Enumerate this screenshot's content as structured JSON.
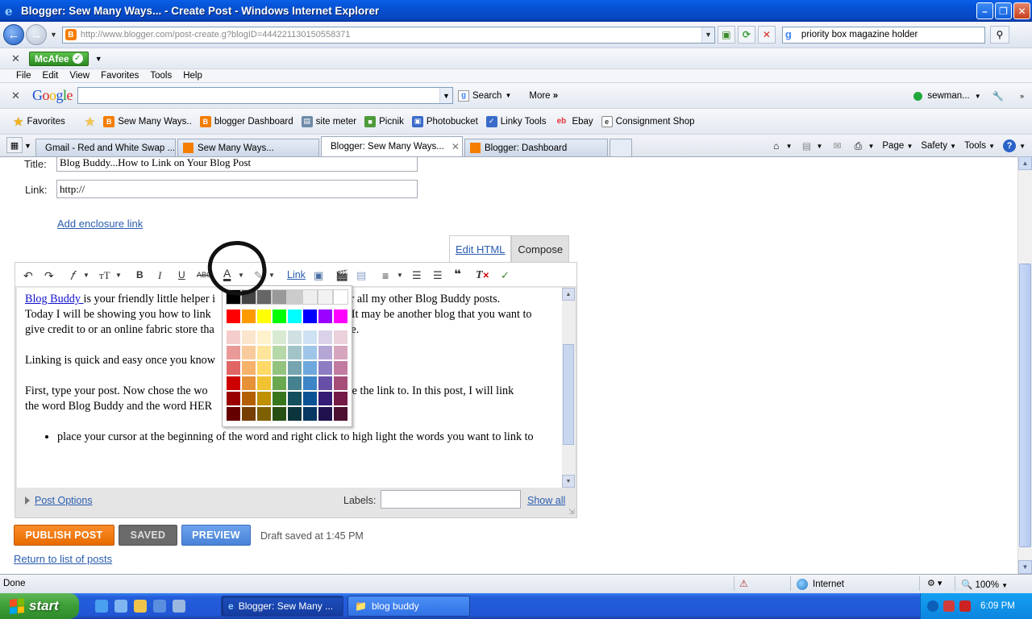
{
  "window": {
    "title": "Blogger: Sew Many Ways... - Create Post - Windows Internet Explorer"
  },
  "address": {
    "url": "http://www.blogger.com/post-create.g?blogID=444221130150558371",
    "search_value": "priority box magazine holder"
  },
  "mcafee": {
    "label": "McAfee"
  },
  "menu": {
    "items": [
      "File",
      "Edit",
      "View",
      "Favorites",
      "Tools",
      "Help"
    ]
  },
  "google_bar": {
    "search_label": "Search",
    "more_label": "More",
    "user": "sewman..."
  },
  "favorites": {
    "label": "Favorites",
    "links": [
      "Sew Many Ways..",
      "blogger Dashboard",
      "site meter",
      "Picnik",
      "Photobucket",
      "Linky Tools",
      "Ebay",
      "Consignment Shop"
    ]
  },
  "tabs": [
    {
      "label": "Gmail - Red and White Swap ..."
    },
    {
      "label": "Sew Many Ways..."
    },
    {
      "label": "Blogger: Sew Many Ways..."
    },
    {
      "label": "Blogger: Dashboard"
    }
  ],
  "command_bar": {
    "page": "Page",
    "safety": "Safety",
    "tools": "Tools"
  },
  "post": {
    "title_label": "Title:",
    "title_value": "Blog Buddy...How to Link on Your Blog Post",
    "link_label": "Link:",
    "link_value": "http://",
    "enclosure_link": "Add enclosure link",
    "edit_html_tab": "Edit HTML",
    "compose_tab": "Compose",
    "toolbar_link": "Link",
    "body": {
      "p1_link": "Blog Buddy ",
      "p1_a": "is your friendly little helper i",
      "p1_b": "RE for all my other Blog Buddy posts.",
      "p1_c": "Today I will be showing you how to link",
      "p1_d": "It may be another blog that you want to",
      "p1_e": "give credit to or an online fabric store tha",
      "p1_f": "share.",
      "p2": "Linking is quick and easy once you know",
      "p3_a": "First, type your post. Now chose the wo",
      "p3_b": "to have the link to. In this post, I will link",
      "p3_c": "the word Blog Buddy and the word HER",
      "bullet": "place your cursor at the beginning of the word and right click to high light the words you want to link to"
    },
    "post_options": "Post Options",
    "labels_label": "Labels:",
    "show_all": "Show all",
    "publish_button": "PUBLISH POST",
    "saved_button": "SAVED",
    "preview_button": "PREVIEW",
    "draft_status": "Draft saved at 1:45 PM",
    "return_link": "Return to list of posts"
  },
  "color_picker": {
    "rows": [
      [
        "#000000",
        "#444444",
        "#666666",
        "#999999",
        "#cccccc",
        "#eeeeee",
        "#f3f3f3",
        "#ffffff"
      ],
      [
        "#ff0000",
        "#ff9900",
        "#ffff00",
        "#00ff00",
        "#00ffff",
        "#0000ff",
        "#9900ff",
        "#ff00ff"
      ],
      [
        "#f4cccc",
        "#fce5cd",
        "#fff2cc",
        "#d9ead3",
        "#d0e0e3",
        "#cfe2f3",
        "#d9d2e9",
        "#ead1dc"
      ],
      [
        "#ea9999",
        "#f9cb9c",
        "#ffe599",
        "#b6d7a8",
        "#a2c4c9",
        "#9fc5e8",
        "#b4a7d6",
        "#d5a6bd"
      ],
      [
        "#e06666",
        "#f6b26b",
        "#ffd966",
        "#93c47d",
        "#76a5af",
        "#6fa8dc",
        "#8e7cc3",
        "#c27ba0"
      ],
      [
        "#cc0000",
        "#e69138",
        "#f1c232",
        "#6aa84f",
        "#45818e",
        "#3d85c6",
        "#674ea7",
        "#a64d79"
      ],
      [
        "#990000",
        "#b45f06",
        "#bf9000",
        "#38761d",
        "#134f5c",
        "#0b5394",
        "#351c75",
        "#741b47"
      ],
      [
        "#660000",
        "#783f04",
        "#7f6000",
        "#274e13",
        "#0c343d",
        "#073763",
        "#20124d",
        "#4c1130"
      ]
    ]
  },
  "status_bar": {
    "status": "Done",
    "zone": "Internet",
    "zoom": "100%"
  },
  "taskbar": {
    "start": "start",
    "task1": "Blogger: Sew Many ...",
    "task2": "blog buddy",
    "clock": "6:09 PM"
  },
  "colors": {
    "accent": "#2a5db0",
    "publish": "#f27c0f",
    "preview": "#5b93e2"
  }
}
